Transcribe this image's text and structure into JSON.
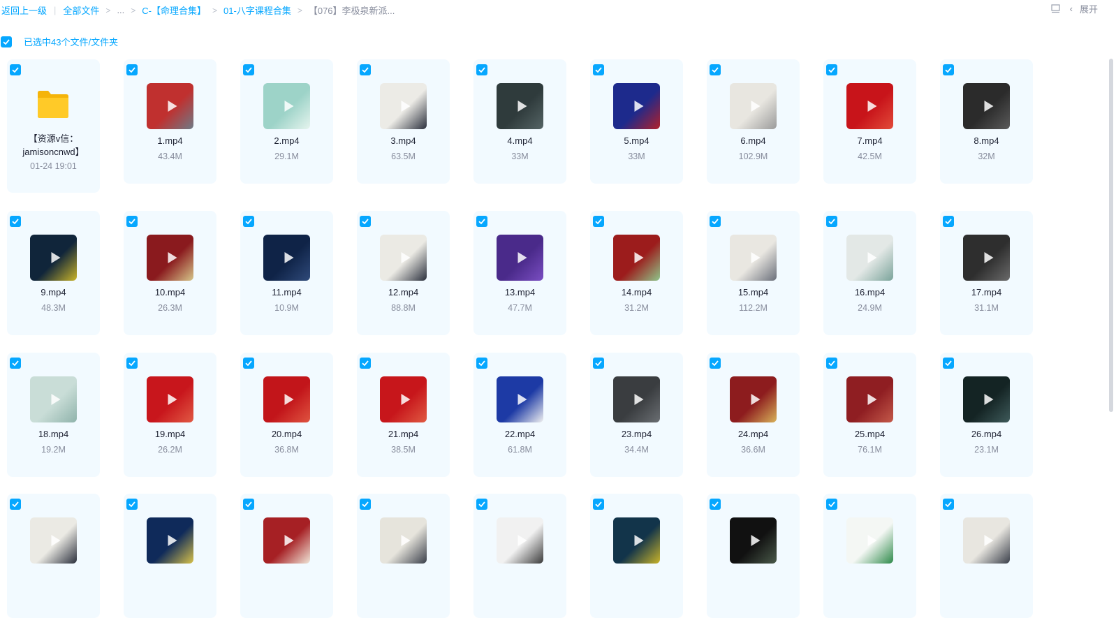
{
  "breadcrumb": {
    "back": "返回上一级",
    "all_files": "全部文件",
    "ellipsis": "...",
    "level1": "C-【命理合集】",
    "level2": "01-八字课程合集",
    "current": "【076】李极泉新派..."
  },
  "toolbar": {
    "expand_label": "展开"
  },
  "selection": {
    "text": "已选中43个文件/文件夹"
  },
  "folder": {
    "name": "【资源v信：jamisoncnwd】",
    "date": "01-24 19:01"
  },
  "files": [
    {
      "name": "1.mp4",
      "size": "43.4M",
      "bg": "#c0302f",
      "bg2": "#6e7b87"
    },
    {
      "name": "2.mp4",
      "size": "29.1M",
      "bg": "#9dd3c8",
      "bg2": "#e6f4ee"
    },
    {
      "name": "3.mp4",
      "size": "63.5M",
      "bg": "#ecebe6",
      "bg2": "#2a2f3c"
    },
    {
      "name": "4.mp4",
      "size": "33M",
      "bg": "#2f3b3c",
      "bg2": "#556465"
    },
    {
      "name": "5.mp4",
      "size": "33M",
      "bg": "#1d2a8c",
      "bg2": "#b2202a"
    },
    {
      "name": "6.mp4",
      "size": "102.9M",
      "bg": "#e8e6e0",
      "bg2": "#9a9a9a"
    },
    {
      "name": "7.mp4",
      "size": "42.5M",
      "bg": "#c8141a",
      "bg2": "#e24b3a"
    },
    {
      "name": "8.mp4",
      "size": "32M",
      "bg": "#2b2b2b",
      "bg2": "#5a5a5a"
    },
    {
      "name": "9.mp4",
      "size": "48.3M",
      "bg": "#10253a",
      "bg2": "#c9b42a"
    },
    {
      "name": "10.mp4",
      "size": "26.3M",
      "bg": "#8a1a1e",
      "bg2": "#d6c68a"
    },
    {
      "name": "11.mp4",
      "size": "10.9M",
      "bg": "#0f2347",
      "bg2": "#2f4a7a"
    },
    {
      "name": "12.mp4",
      "size": "88.8M",
      "bg": "#ebeae4",
      "bg2": "#2a2f3c"
    },
    {
      "name": "13.mp4",
      "size": "47.7M",
      "bg": "#4a2a8a",
      "bg2": "#7a4ec2"
    },
    {
      "name": "14.mp4",
      "size": "31.2M",
      "bg": "#9c1c1c",
      "bg2": "#8ec58a"
    },
    {
      "name": "15.mp4",
      "size": "112.2M",
      "bg": "#e9e7e1",
      "bg2": "#6a6f7a"
    },
    {
      "name": "16.mp4",
      "size": "24.9M",
      "bg": "#e3e8e6",
      "bg2": "#7aa39a"
    },
    {
      "name": "17.mp4",
      "size": "31.1M",
      "bg": "#2e2e2e",
      "bg2": "#6a6a6a"
    },
    {
      "name": "18.mp4",
      "size": "19.2M",
      "bg": "#c9ddd7",
      "bg2": "#8fb3ab"
    },
    {
      "name": "19.mp4",
      "size": "26.2M",
      "bg": "#c8161c",
      "bg2": "#e15a44"
    },
    {
      "name": "20.mp4",
      "size": "36.8M",
      "bg": "#c2151a",
      "bg2": "#df5440"
    },
    {
      "name": "21.mp4",
      "size": "38.5M",
      "bg": "#c7161b",
      "bg2": "#e05a42"
    },
    {
      "name": "22.mp4",
      "size": "61.8M",
      "bg": "#1d3aa5",
      "bg2": "#f0f0f0"
    },
    {
      "name": "23.mp4",
      "size": "34.4M",
      "bg": "#3a3d40",
      "bg2": "#6a6e72"
    },
    {
      "name": "24.mp4",
      "size": "36.6M",
      "bg": "#8d1c1e",
      "bg2": "#d8b25a"
    },
    {
      "name": "25.mp4",
      "size": "76.1M",
      "bg": "#8f1e22",
      "bg2": "#c45a4a"
    },
    {
      "name": "26.mp4",
      "size": "23.1M",
      "bg": "#142424",
      "bg2": "#3e5a5a"
    },
    {
      "name": "",
      "size": "",
      "bg": "#ebeae4",
      "bg2": "#2a2f3c"
    },
    {
      "name": "",
      "size": "",
      "bg": "#0f2a5a",
      "bg2": "#d8c24a"
    },
    {
      "name": "",
      "size": "",
      "bg": "#a62024",
      "bg2": "#f0e6d8"
    },
    {
      "name": "",
      "size": "",
      "bg": "#e6e4dc",
      "bg2": "#3a3f4a"
    },
    {
      "name": "",
      "size": "",
      "bg": "#f1f1f1",
      "bg2": "#3a3a3a"
    },
    {
      "name": "",
      "size": "",
      "bg": "#12344a",
      "bg2": "#c9b42a"
    },
    {
      "name": "",
      "size": "",
      "bg": "#111111",
      "bg2": "#4a5a4a"
    },
    {
      "name": "",
      "size": "",
      "bg": "#f4f7f4",
      "bg2": "#2e8a4a"
    },
    {
      "name": "",
      "size": "",
      "bg": "#e8e6e0",
      "bg2": "#3a3f4a"
    }
  ]
}
